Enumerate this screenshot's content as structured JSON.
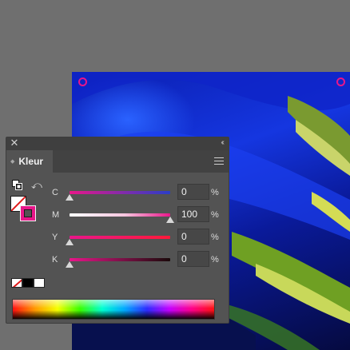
{
  "panel": {
    "close_glyph": "✕",
    "collapse_glyph": "‹‹",
    "tab_label": "Kleur",
    "menu_icon": "hamburger-icon"
  },
  "channels": [
    {
      "name": "C",
      "value": "0",
      "unit": "%",
      "level": 0,
      "color": "#2a3ec8"
    },
    {
      "name": "M",
      "value": "100",
      "unit": "%",
      "level": 1,
      "color": "#e8168a"
    },
    {
      "name": "Y",
      "value": "0",
      "unit": "%",
      "level": 0,
      "color": "#ff1a4d"
    },
    {
      "name": "K",
      "value": "0",
      "unit": "%",
      "level": 0,
      "color": "#1a0a0a"
    }
  ],
  "colors": {
    "accent": "#e8168a",
    "panel_bg": "#535353",
    "canvas_bg": "#6f6f6f"
  },
  "icons": {
    "default_colors": "default-fill-stroke-icon",
    "swap": "swap-fill-stroke-icon",
    "swap_glyph": "⤺"
  }
}
